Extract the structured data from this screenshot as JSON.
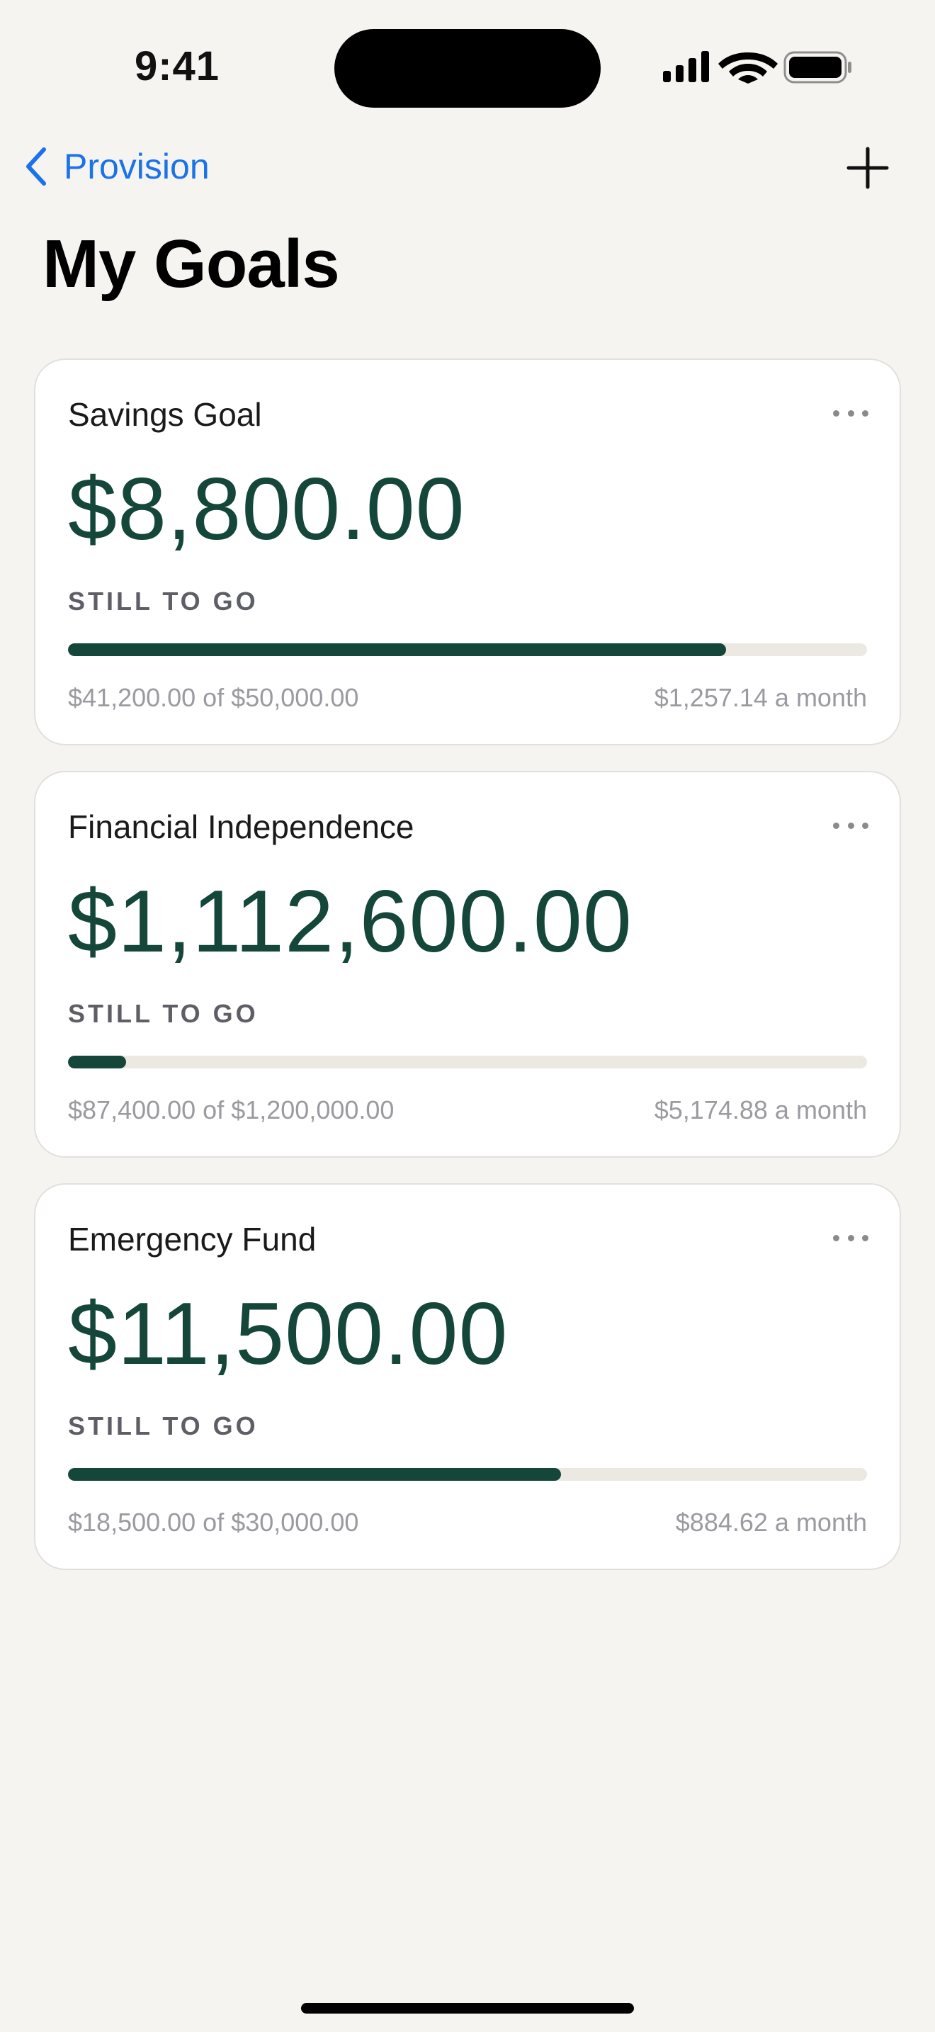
{
  "status_bar": {
    "time": "9:41",
    "icons": [
      "cellular-signal-icon",
      "wifi-icon",
      "battery-icon"
    ]
  },
  "nav": {
    "back_label": "Provision",
    "back_icon": "chevron-left-icon",
    "add_icon": "plus-icon"
  },
  "page": {
    "title": "My Goals"
  },
  "colors": {
    "accent_blue": "#1a73e8",
    "amount_green": "#14463a",
    "progress_track": "#ece9e3",
    "background": "#f5f4f1"
  },
  "goals": [
    {
      "name": "Savings Goal",
      "remaining": "$8,800.00",
      "remaining_label": "STILL TO GO",
      "progress_text": "$41,200.00 of $50,000.00",
      "monthly_text": "$1,257.14 a month",
      "progress_percent": 82.4
    },
    {
      "name": "Financial Independence",
      "remaining": "$1,112,600.00",
      "remaining_label": "STILL TO GO",
      "progress_text": "$87,400.00 of $1,200,000.00",
      "monthly_text": "$5,174.88 a month",
      "progress_percent": 7.3
    },
    {
      "name": "Emergency Fund",
      "remaining": "$11,500.00",
      "remaining_label": "STILL TO GO",
      "progress_text": "$18,500.00 of $30,000.00",
      "monthly_text": "$884.62 a month",
      "progress_percent": 61.7
    }
  ]
}
